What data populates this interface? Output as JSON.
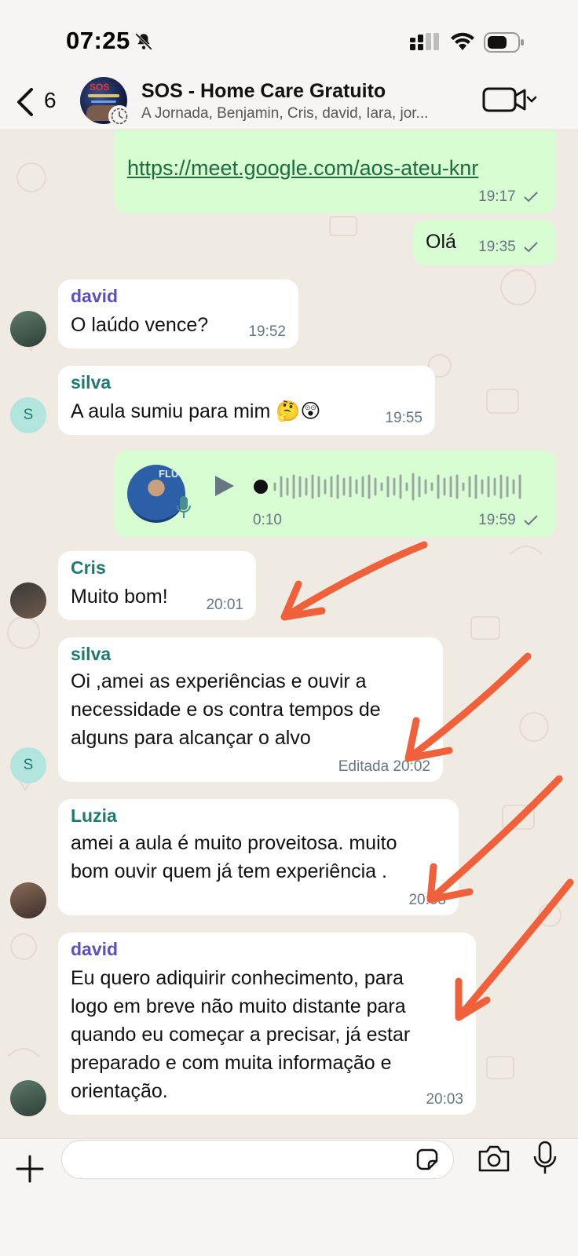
{
  "status_bar": {
    "time": "07:25"
  },
  "header": {
    "unread_count": "6",
    "group_name": "SOS - Home Care Gratuito",
    "participants": "A Jornada, Benjamin, Cris, david, Iara, jor..."
  },
  "messages": [
    {
      "type": "outgoing",
      "text": "https://meet.google.com/aos-ateu-knr",
      "time": "19:17"
    },
    {
      "type": "outgoing",
      "text": "Olá",
      "time": "19:35"
    },
    {
      "type": "incoming",
      "sender": "david",
      "text": "O laúdo vence?",
      "time": "19:52"
    },
    {
      "type": "incoming",
      "sender": "silva",
      "avatar_initial": "S",
      "text": "A aula sumiu para mim 🤔😲",
      "time": "19:55"
    },
    {
      "type": "outgoing-voice",
      "duration": "0:10",
      "time": "19:59",
      "thumb_text": "FLU"
    },
    {
      "type": "incoming",
      "sender": "Cris",
      "text": "Muito bom!",
      "time": "20:01"
    },
    {
      "type": "incoming",
      "sender": "silva",
      "avatar_initial": "S",
      "lines": [
        "Oi ,amei as experiências e ouvir a",
        "necessidade e os contra tempos de",
        "alguns para alcançar o alvo"
      ],
      "time": "Editada 20:02"
    },
    {
      "type": "incoming",
      "sender": "Luzia",
      "lines": [
        "amei a aula é muito proveitosa. muito",
        "bom ouvir quem já tem experiência ."
      ],
      "time": "20:03"
    },
    {
      "type": "incoming",
      "sender": "david",
      "lines": [
        "Eu quero adiquirir conhecimento, para",
        "logo em breve não muito distante para",
        "quando eu começar a precisar, já estar",
        "preparado e com muita informação e",
        "orientação."
      ],
      "time": "20:03"
    }
  ],
  "colors": {
    "outgoing_bubble": "#d9fdd3",
    "incoming_bubble": "#ffffff",
    "sender_david": "#5b4fc4",
    "sender_green": "#1f7a6e",
    "annotation_arrow": "#f0603a"
  },
  "composer": {
    "placeholder": ""
  }
}
